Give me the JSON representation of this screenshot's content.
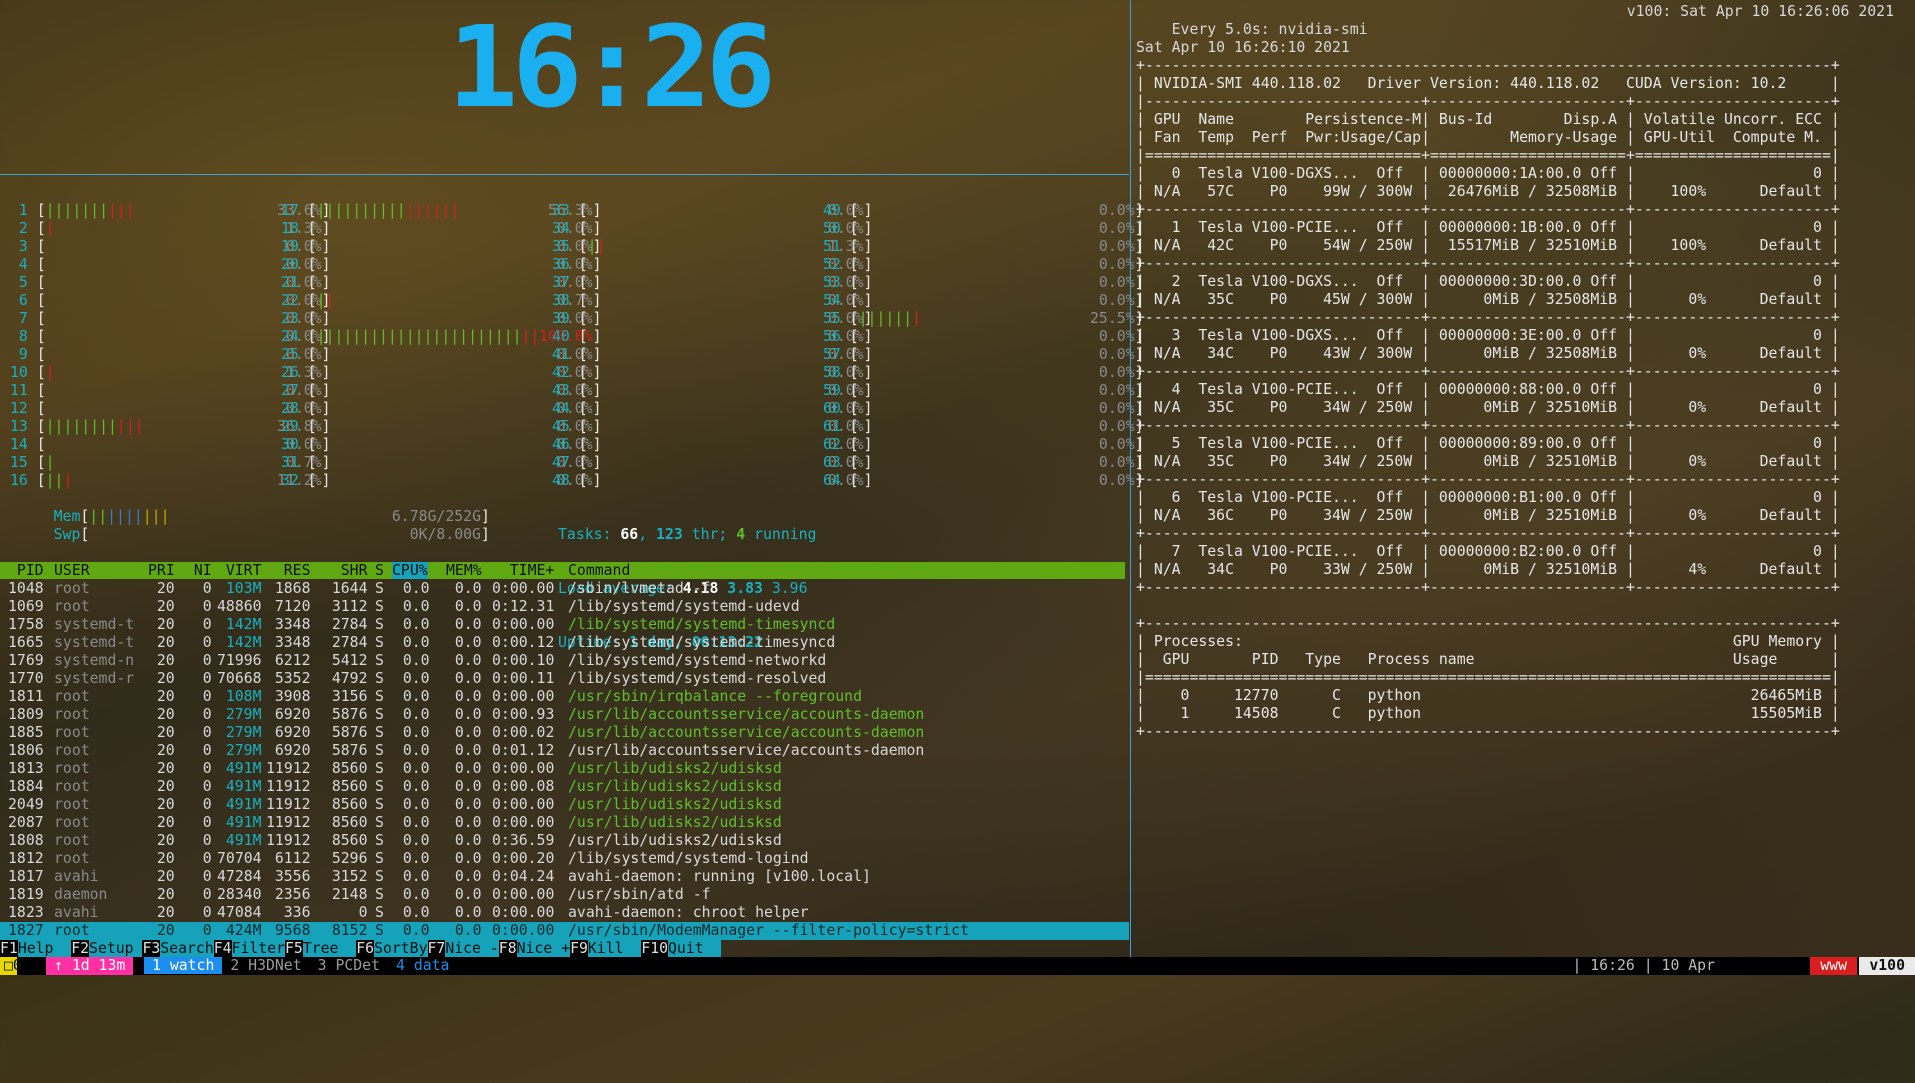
{
  "clock": "16:26",
  "cpus": [
    {
      "n": "1",
      "g": 7,
      "r": 3,
      "pct": "33.6%"
    },
    {
      "n": "2",
      "g": 0,
      "r": 1,
      "pct": "1.3%"
    },
    {
      "n": "3",
      "g": 0,
      "r": 0,
      "pct": "0.0%"
    },
    {
      "n": "4",
      "g": 0,
      "r": 0,
      "pct": "0.0%"
    },
    {
      "n": "5",
      "g": 0,
      "r": 0,
      "pct": "0.0%"
    },
    {
      "n": "6",
      "g": 0,
      "r": 0,
      "pct": "0.0%"
    },
    {
      "n": "7",
      "g": 0,
      "r": 0,
      "pct": "0.0%"
    },
    {
      "n": "8",
      "g": 0,
      "r": 0,
      "pct": "0.0%"
    },
    {
      "n": "9",
      "g": 0,
      "r": 0,
      "pct": "0.0%"
    },
    {
      "n": "10",
      "g": 0,
      "r": 1,
      "pct": "1.3%"
    },
    {
      "n": "11",
      "g": 0,
      "r": 0,
      "pct": "0.0%"
    },
    {
      "n": "12",
      "g": 0,
      "r": 0,
      "pct": "0.0%"
    },
    {
      "n": "13",
      "g": 8,
      "r": 3,
      "pct": "36.8%"
    },
    {
      "n": "14",
      "g": 0,
      "r": 0,
      "pct": "0.0%"
    },
    {
      "n": "15",
      "g": 1,
      "r": 0,
      "pct": "0.7%"
    },
    {
      "n": "16",
      "g": 2,
      "r": 1,
      "pct": "11.2%"
    },
    {
      "n": "17",
      "g": 10,
      "r": 6,
      "pct": "56.3%"
    },
    {
      "n": "18",
      "g": 0,
      "r": 0,
      "pct": "0.0%"
    },
    {
      "n": "19",
      "g": 0,
      "r": 0,
      "pct": "0.0%"
    },
    {
      "n": "20",
      "g": 0,
      "r": 0,
      "pct": "0.0%"
    },
    {
      "n": "21",
      "g": 0,
      "r": 0,
      "pct": "0.0%"
    },
    {
      "n": "22",
      "g": 1,
      "r": 1,
      "pct": "0.7%"
    },
    {
      "n": "23",
      "g": 0,
      "r": 0,
      "pct": "0.0%"
    },
    {
      "n": "24",
      "g": 23,
      "r": 2,
      "pct": "100.0%"
    },
    {
      "n": "25",
      "g": 0,
      "r": 0,
      "pct": "0.0%"
    },
    {
      "n": "26",
      "g": 0,
      "r": 0,
      "pct": "0.0%"
    },
    {
      "n": "27",
      "g": 0,
      "r": 0,
      "pct": "0.0%"
    },
    {
      "n": "28",
      "g": 0,
      "r": 0,
      "pct": "0.0%"
    },
    {
      "n": "29",
      "g": 0,
      "r": 0,
      "pct": "0.0%"
    },
    {
      "n": "30",
      "g": 0,
      "r": 0,
      "pct": "0.0%"
    },
    {
      "n": "31",
      "g": 0,
      "r": 0,
      "pct": "0.0%"
    },
    {
      "n": "32",
      "g": 0,
      "r": 0,
      "pct": "0.0%"
    },
    {
      "n": "33",
      "g": 0,
      "r": 0,
      "pct": "0.0%"
    },
    {
      "n": "34",
      "g": 0,
      "r": 0,
      "pct": "0.0%"
    },
    {
      "n": "35",
      "g": 1,
      "r": 1,
      "pct": "1.3%"
    },
    {
      "n": "36",
      "g": 0,
      "r": 0,
      "pct": "0.0%"
    },
    {
      "n": "37",
      "g": 0,
      "r": 0,
      "pct": "0.0%"
    },
    {
      "n": "38",
      "g": 0,
      "r": 0,
      "pct": "0.0%"
    },
    {
      "n": "39",
      "g": 0,
      "r": 0,
      "pct": "0.0%"
    },
    {
      "n": "40",
      "g": 0,
      "r": 0,
      "pct": "0.0%"
    },
    {
      "n": "41",
      "g": 0,
      "r": 0,
      "pct": "0.0%"
    },
    {
      "n": "42",
      "g": 0,
      "r": 0,
      "pct": "0.0%"
    },
    {
      "n": "43",
      "g": 0,
      "r": 0,
      "pct": "0.0%"
    },
    {
      "n": "44",
      "g": 0,
      "r": 0,
      "pct": "0.0%"
    },
    {
      "n": "45",
      "g": 0,
      "r": 0,
      "pct": "0.0%"
    },
    {
      "n": "46",
      "g": 0,
      "r": 0,
      "pct": "0.0%"
    },
    {
      "n": "47",
      "g": 0,
      "r": 0,
      "pct": "0.0%"
    },
    {
      "n": "48",
      "g": 0,
      "r": 0,
      "pct": "0.0%"
    },
    {
      "n": "49",
      "g": 0,
      "r": 0,
      "pct": "0.0%"
    },
    {
      "n": "50",
      "g": 0,
      "r": 0,
      "pct": "0.0%"
    },
    {
      "n": "51",
      "g": 0,
      "r": 0,
      "pct": "0.0%"
    },
    {
      "n": "52",
      "g": 0,
      "r": 0,
      "pct": "0.0%"
    },
    {
      "n": "53",
      "g": 0,
      "r": 0,
      "pct": "0.0%"
    },
    {
      "n": "54",
      "g": 0,
      "r": 0,
      "pct": "0.0%"
    },
    {
      "n": "55",
      "g": 6,
      "r": 1,
      "pct": "25.5%"
    },
    {
      "n": "56",
      "g": 0,
      "r": 0,
      "pct": "0.0%"
    },
    {
      "n": "57",
      "g": 0,
      "r": 0,
      "pct": "0.0%"
    },
    {
      "n": "58",
      "g": 0,
      "r": 0,
      "pct": "0.0%"
    },
    {
      "n": "59",
      "g": 0,
      "r": 0,
      "pct": "0.0%"
    },
    {
      "n": "60",
      "g": 0,
      "r": 0,
      "pct": "0.0%"
    },
    {
      "n": "61",
      "g": 0,
      "r": 0,
      "pct": "0.0%"
    },
    {
      "n": "62",
      "g": 0,
      "r": 0,
      "pct": "0.0%"
    },
    {
      "n": "63",
      "g": 0,
      "r": 0,
      "pct": "0.0%"
    },
    {
      "n": "64",
      "g": 0,
      "r": 0,
      "pct": "0.0%"
    }
  ],
  "mem": {
    "label": "Mem",
    "bars": 9,
    "value": "6.78G/252G"
  },
  "swp": {
    "label": "Swp",
    "bars": 0,
    "value": "0K/8.00G"
  },
  "tasks": {
    "label": "Tasks:",
    "count": "66",
    "thr": "123",
    "thr_label": "thr;",
    "running": "4",
    "running_label": "running"
  },
  "load": {
    "label": "Load average:",
    "l1": "4.18",
    "l5": "3.83",
    "l15": "3.96"
  },
  "uptime": {
    "label": "Uptime:",
    "value": "1 day, 00:13:22"
  },
  "proc_headers": [
    "PID",
    "USER",
    "PRI",
    "NI",
    "VIRT",
    "RES",
    "SHR",
    "S",
    "CPU%",
    "MEM%",
    "TIME+",
    "Command"
  ],
  "processes": [
    {
      "pid": "1048",
      "user": "root",
      "pri": "20",
      "ni": "0",
      "virt": "103M",
      "res": "1868",
      "shr": "1644",
      "s": "S",
      "cpu": "0.0",
      "mem": "0.0",
      "time": "0:00.00",
      "cmd": "/sbin/lvmetad -f",
      "thread": false
    },
    {
      "pid": "1069",
      "user": "root",
      "pri": "20",
      "ni": "0",
      "virt": "48860",
      "res": "7120",
      "shr": "3112",
      "s": "S",
      "cpu": "0.0",
      "mem": "0.0",
      "time": "0:12.31",
      "cmd": "/lib/systemd/systemd-udevd",
      "thread": false
    },
    {
      "pid": "1758",
      "user": "systemd-t",
      "pri": "20",
      "ni": "0",
      "virt": "142M",
      "res": "3348",
      "shr": "2784",
      "s": "S",
      "cpu": "0.0",
      "mem": "0.0",
      "time": "0:00.00",
      "cmd": "/lib/systemd/systemd-timesyncd",
      "thread": true
    },
    {
      "pid": "1665",
      "user": "systemd-t",
      "pri": "20",
      "ni": "0",
      "virt": "142M",
      "res": "3348",
      "shr": "2784",
      "s": "S",
      "cpu": "0.0",
      "mem": "0.0",
      "time": "0:00.12",
      "cmd": "/lib/systemd/systemd-timesyncd",
      "thread": false
    },
    {
      "pid": "1769",
      "user": "systemd-n",
      "pri": "20",
      "ni": "0",
      "virt": "71996",
      "res": "6212",
      "shr": "5412",
      "s": "S",
      "cpu": "0.0",
      "mem": "0.0",
      "time": "0:00.10",
      "cmd": "/lib/systemd/systemd-networkd",
      "thread": false
    },
    {
      "pid": "1770",
      "user": "systemd-r",
      "pri": "20",
      "ni": "0",
      "virt": "70668",
      "res": "5352",
      "shr": "4792",
      "s": "S",
      "cpu": "0.0",
      "mem": "0.0",
      "time": "0:00.11",
      "cmd": "/lib/systemd/systemd-resolved",
      "thread": false
    },
    {
      "pid": "1811",
      "user": "root",
      "pri": "20",
      "ni": "0",
      "virt": "108M",
      "res": "3908",
      "shr": "3156",
      "s": "S",
      "cpu": "0.0",
      "mem": "0.0",
      "time": "0:00.00",
      "cmd": "/usr/sbin/irqbalance --foreground",
      "thread": true
    },
    {
      "pid": "1809",
      "user": "root",
      "pri": "20",
      "ni": "0",
      "virt": "279M",
      "res": "6920",
      "shr": "5876",
      "s": "S",
      "cpu": "0.0",
      "mem": "0.0",
      "time": "0:00.93",
      "cmd": "/usr/lib/accountsservice/accounts-daemon",
      "thread": true
    },
    {
      "pid": "1885",
      "user": "root",
      "pri": "20",
      "ni": "0",
      "virt": "279M",
      "res": "6920",
      "shr": "5876",
      "s": "S",
      "cpu": "0.0",
      "mem": "0.0",
      "time": "0:00.02",
      "cmd": "/usr/lib/accountsservice/accounts-daemon",
      "thread": true
    },
    {
      "pid": "1806",
      "user": "root",
      "pri": "20",
      "ni": "0",
      "virt": "279M",
      "res": "6920",
      "shr": "5876",
      "s": "S",
      "cpu": "0.0",
      "mem": "0.0",
      "time": "0:01.12",
      "cmd": "/usr/lib/accountsservice/accounts-daemon",
      "thread": false
    },
    {
      "pid": "1813",
      "user": "root",
      "pri": "20",
      "ni": "0",
      "virt": "491M",
      "res": "11912",
      "shr": "8560",
      "s": "S",
      "cpu": "0.0",
      "mem": "0.0",
      "time": "0:00.00",
      "cmd": "/usr/lib/udisks2/udisksd",
      "thread": true
    },
    {
      "pid": "1884",
      "user": "root",
      "pri": "20",
      "ni": "0",
      "virt": "491M",
      "res": "11912",
      "shr": "8560",
      "s": "S",
      "cpu": "0.0",
      "mem": "0.0",
      "time": "0:00.08",
      "cmd": "/usr/lib/udisks2/udisksd",
      "thread": true
    },
    {
      "pid": "2049",
      "user": "root",
      "pri": "20",
      "ni": "0",
      "virt": "491M",
      "res": "11912",
      "shr": "8560",
      "s": "S",
      "cpu": "0.0",
      "mem": "0.0",
      "time": "0:00.00",
      "cmd": "/usr/lib/udisks2/udisksd",
      "thread": true
    },
    {
      "pid": "2087",
      "user": "root",
      "pri": "20",
      "ni": "0",
      "virt": "491M",
      "res": "11912",
      "shr": "8560",
      "s": "S",
      "cpu": "0.0",
      "mem": "0.0",
      "time": "0:00.00",
      "cmd": "/usr/lib/udisks2/udisksd",
      "thread": true
    },
    {
      "pid": "1808",
      "user": "root",
      "pri": "20",
      "ni": "0",
      "virt": "491M",
      "res": "11912",
      "shr": "8560",
      "s": "S",
      "cpu": "0.0",
      "mem": "0.0",
      "time": "0:36.59",
      "cmd": "/usr/lib/udisks2/udisksd",
      "thread": false
    },
    {
      "pid": "1812",
      "user": "root",
      "pri": "20",
      "ni": "0",
      "virt": "70704",
      "res": "6112",
      "shr": "5296",
      "s": "S",
      "cpu": "0.0",
      "mem": "0.0",
      "time": "0:00.20",
      "cmd": "/lib/systemd/systemd-logind",
      "thread": false
    },
    {
      "pid": "1817",
      "user": "avahi",
      "pri": "20",
      "ni": "0",
      "virt": "47284",
      "res": "3556",
      "shr": "3152",
      "s": "S",
      "cpu": "0.0",
      "mem": "0.0",
      "time": "0:04.24",
      "cmd": "avahi-daemon: running [v100.local]",
      "thread": false
    },
    {
      "pid": "1819",
      "user": "daemon",
      "pri": "20",
      "ni": "0",
      "virt": "28340",
      "res": "2356",
      "shr": "2148",
      "s": "S",
      "cpu": "0.0",
      "mem": "0.0",
      "time": "0:00.00",
      "cmd": "/usr/sbin/atd -f",
      "thread": false
    },
    {
      "pid": "1823",
      "user": "avahi",
      "pri": "20",
      "ni": "0",
      "virt": "47084",
      "res": "336",
      "shr": "0",
      "s": "S",
      "cpu": "0.0",
      "mem": "0.0",
      "time": "0:00.00",
      "cmd": "avahi-daemon: chroot helper",
      "thread": false
    },
    {
      "pid": "1827",
      "user": "root",
      "pri": "20",
      "ni": "0",
      "virt": "424M",
      "res": "9568",
      "shr": "8152",
      "s": "S",
      "cpu": "0.0",
      "mem": "0.0",
      "time": "0:00.00",
      "cmd": "/usr/sbin/ModemManager --filter-policy=strict",
      "thread": false,
      "selected": true
    }
  ],
  "fkeys": [
    {
      "key": "F1",
      "label": "Help"
    },
    {
      "key": "F2",
      "label": "Setup"
    },
    {
      "key": "F3",
      "label": "Search"
    },
    {
      "key": "F4",
      "label": "Filter"
    },
    {
      "key": "F5",
      "label": "Tree"
    },
    {
      "key": "F6",
      "label": "SortBy"
    },
    {
      "key": "F7",
      "label": "Nice -"
    },
    {
      "key": "F8",
      "label": "Nice +"
    },
    {
      "key": "F9",
      "label": "Kill"
    },
    {
      "key": "F10",
      "label": "Quit"
    }
  ],
  "tmux": {
    "session": "0",
    "uptime_badge": "↑ 1d 13m",
    "windows": [
      {
        "label": "1 watch",
        "active": true
      },
      {
        "label": "2 H3DNet",
        "active": false
      },
      {
        "label": "3 PCDet",
        "active": false
      },
      {
        "label": "4 data",
        "active": false
      }
    ],
    "status_time": "| 16:26 | 10 Apr",
    "www": "www",
    "host": "v100"
  },
  "nvidia": {
    "header_left": "Every 5.0s: nvidia-smi",
    "header_right": "v100: Sat Apr 10 16:26:06 2021",
    "date": "Sat Apr 10 16:26:10 2021",
    "lines": [
      "+-----------------------------------------------------------------------------+",
      "| NVIDIA-SMI 440.118.02   Driver Version: 440.118.02   CUDA Version: 10.2     |",
      "|-------------------------------+----------------------+----------------------+",
      "| GPU  Name        Persistence-M| Bus-Id        Disp.A | Volatile Uncorr. ECC |",
      "| Fan  Temp  Perf  Pwr:Usage/Cap|         Memory-Usage | GPU-Util  Compute M. |",
      "|===============================+======================+======================|",
      "|   0  Tesla V100-DGXS...  Off  | 00000000:1A:00.0 Off |                    0 |",
      "| N/A   57C    P0    99W / 300W |  26476MiB / 32508MiB |    100%      Default |",
      "+-------------------------------+----------------------+----------------------+",
      "|   1  Tesla V100-PCIE...  Off  | 00000000:1B:00.0 Off |                    0 |",
      "| N/A   42C    P0    54W / 250W |  15517MiB / 32510MiB |    100%      Default |",
      "+-------------------------------+----------------------+----------------------+",
      "|   2  Tesla V100-DGXS...  Off  | 00000000:3D:00.0 Off |                    0 |",
      "| N/A   35C    P0    45W / 300W |      0MiB / 32508MiB |      0%      Default |",
      "+-------------------------------+----------------------+----------------------+",
      "|   3  Tesla V100-DGXS...  Off  | 00000000:3E:00.0 Off |                    0 |",
      "| N/A   34C    P0    43W / 300W |      0MiB / 32508MiB |      0%      Default |",
      "+-------------------------------+----------------------+----------------------+",
      "|   4  Tesla V100-PCIE...  Off  | 00000000:88:00.0 Off |                    0 |",
      "| N/A   35C    P0    34W / 250W |      0MiB / 32510MiB |      0%      Default |",
      "+-------------------------------+----------------------+----------------------+",
      "|   5  Tesla V100-PCIE...  Off  | 00000000:89:00.0 Off |                    0 |",
      "| N/A   35C    P0    34W / 250W |      0MiB / 32510MiB |      0%      Default |",
      "+-------------------------------+----------------------+----------------------+",
      "|   6  Tesla V100-PCIE...  Off  | 00000000:B1:00.0 Off |                    0 |",
      "| N/A   36C    P0    34W / 250W |      0MiB / 32510MiB |      0%      Default |",
      "+-------------------------------+----------------------+----------------------+",
      "|   7  Tesla V100-PCIE...  Off  | 00000000:B2:00.0 Off |                    0 |",
      "| N/A   34C    P0    33W / 250W |      0MiB / 32510MiB |      4%      Default |",
      "+-------------------------------+----------------------+----------------------+",
      "",
      "+-----------------------------------------------------------------------------+",
      "| Processes:                                                       GPU Memory |",
      "|  GPU       PID   Type   Process name                             Usage      |",
      "|=============================================================================|",
      "|    0     12770      C   python                                     26465MiB |",
      "|    1     14508      C   python                                     15505MiB |",
      "+-----------------------------------------------------------------------------+"
    ]
  },
  "colors": {
    "cyan": "#16b1c0",
    "green": "#5fbf2a",
    "red": "#d02020",
    "clock": "#1ab0f0",
    "separator": "#3da0d8"
  }
}
